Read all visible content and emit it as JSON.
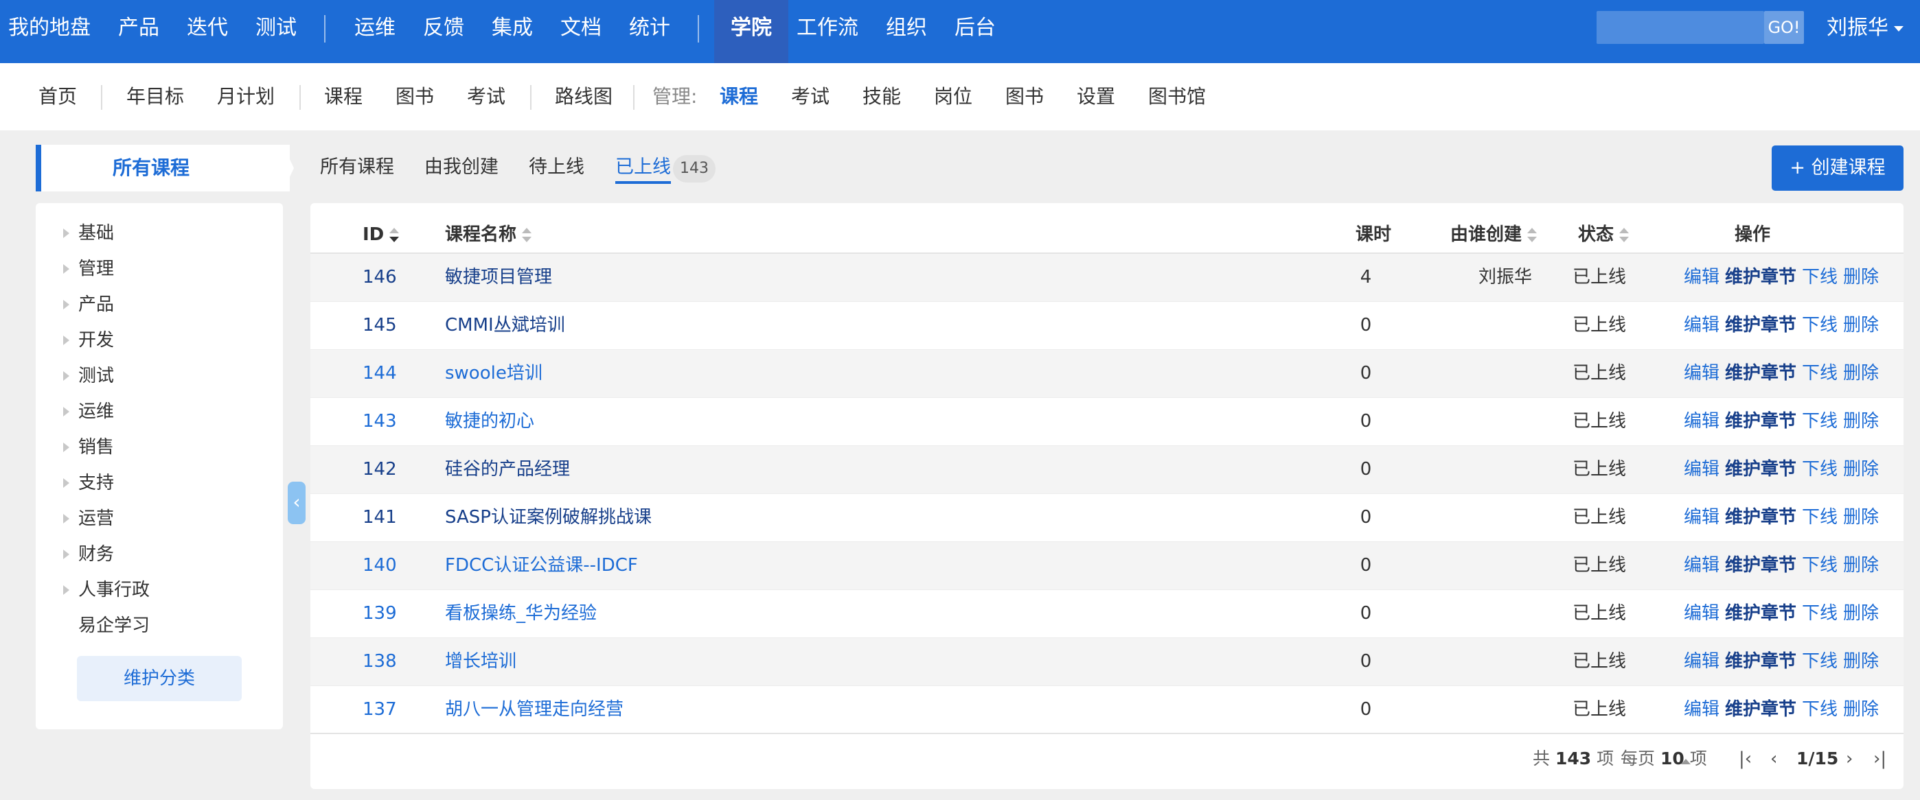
{
  "topnav": {
    "items": [
      "我的地盘",
      "产品",
      "迭代",
      "测试",
      "运维",
      "反馈",
      "集成",
      "文档",
      "统计",
      "学院",
      "工作流",
      "组织",
      "后台"
    ],
    "go": "GO!",
    "user": "刘振华"
  },
  "subnav": {
    "items": [
      "首页",
      "年目标",
      "月计划",
      "课程",
      "图书",
      "考试",
      "路线图",
      "管理:",
      "课程",
      "考试",
      "技能",
      "岗位",
      "图书",
      "设置",
      "图书馆"
    ]
  },
  "sidebar": {
    "title": "所有课程",
    "categories": [
      "基础",
      "管理",
      "产品",
      "开发",
      "测试",
      "运维",
      "销售",
      "支持",
      "运营",
      "财务",
      "人事行政",
      "易企学习"
    ],
    "maintain": "维护分类"
  },
  "tabs": {
    "items": [
      "所有课程",
      "由我创建",
      "待上线",
      "已上线"
    ],
    "badge": "143",
    "create": "+ 创建课程"
  },
  "table": {
    "headers": {
      "id": "ID",
      "name": "课程名称",
      "hours": "课时",
      "creator": "由谁创建",
      "status": "状态",
      "ops": "操作"
    },
    "ops": [
      "编辑",
      "维护章节",
      "下线",
      "删除"
    ],
    "rows": [
      {
        "id": "146",
        "name": "敏捷项目管理",
        "hours": "4",
        "creator": "刘振华",
        "status": "已上线"
      },
      {
        "id": "145",
        "name": "CMMI丛斌培训",
        "hours": "0",
        "creator": "",
        "status": "已上线"
      },
      {
        "id": "144",
        "name": "swoole培训",
        "hours": "0",
        "creator": "",
        "status": "已上线"
      },
      {
        "id": "143",
        "name": "敏捷的初心",
        "hours": "0",
        "creator": "",
        "status": "已上线"
      },
      {
        "id": "142",
        "name": "硅谷的产品经理",
        "hours": "0",
        "creator": "",
        "status": "已上线"
      },
      {
        "id": "141",
        "name": "SASP认证案例破解挑战课",
        "hours": "0",
        "creator": "",
        "status": "已上线"
      },
      {
        "id": "140",
        "name": "FDCC认证公益课--IDCF",
        "hours": "0",
        "creator": "",
        "status": "已上线"
      },
      {
        "id": "139",
        "name": "看板操练_华为经验",
        "hours": "0",
        "creator": "",
        "status": "已上线"
      },
      {
        "id": "138",
        "name": "增长培训",
        "hours": "0",
        "creator": "",
        "status": "已上线"
      },
      {
        "id": "137",
        "name": "胡八一从管理走向经营",
        "hours": "0",
        "creator": "",
        "status": "已上线"
      }
    ]
  },
  "pager": {
    "total_prefix": "共",
    "total": "143",
    "total_suffix": "项",
    "per_prefix": "每页",
    "per": "10",
    "per_suffix": "项",
    "page": "1/15"
  }
}
